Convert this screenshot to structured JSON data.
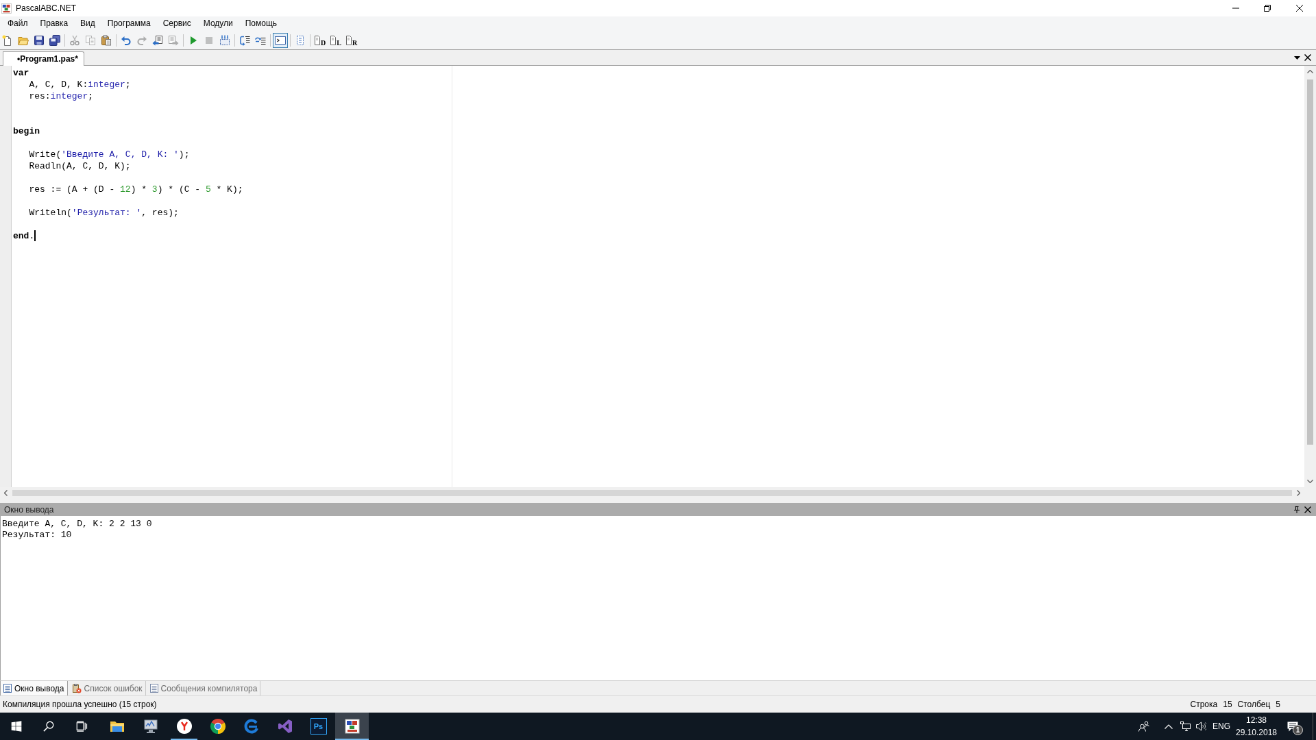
{
  "window": {
    "title": "PascalABC.NET"
  },
  "menu": [
    "Файл",
    "Правка",
    "Вид",
    "Программа",
    "Сервис",
    "Модули",
    "Помощь"
  ],
  "toolbar": {
    "groups": [
      {
        "buttons": [
          {
            "disabled": false,
            "pressed": false
          },
          {
            "disabled": false,
            "pressed": false
          },
          {
            "disabled": false,
            "pressed": false
          },
          {
            "disabled": false,
            "pressed": false
          }
        ]
      },
      {
        "buttons": [
          {
            "disabled": true,
            "pressed": false
          },
          {
            "disabled": true,
            "pressed": false
          },
          {
            "disabled": false,
            "pressed": false
          }
        ]
      },
      {
        "buttons": [
          {
            "disabled": false,
            "pressed": false
          },
          {
            "disabled": true,
            "pressed": false
          },
          {
            "disabled": false,
            "pressed": false
          },
          {
            "disabled": true,
            "pressed": false
          }
        ]
      },
      {
        "buttons": [
          {
            "disabled": false,
            "pressed": false
          },
          {
            "disabled": true,
            "pressed": false
          },
          {
            "disabled": false,
            "pressed": false
          }
        ]
      },
      {
        "buttons": [
          {
            "disabled": false,
            "pressed": false
          },
          {
            "disabled": false,
            "pressed": false
          }
        ]
      },
      {
        "buttons": [
          {
            "disabled": false,
            "pressed": true
          }
        ]
      },
      {
        "buttons": [
          {
            "disabled": false,
            "pressed": false
          }
        ]
      },
      {
        "buttons": [
          {
            "label": "D",
            "disabled": false,
            "pressed": false
          },
          {
            "label": "L",
            "disabled": false,
            "pressed": false
          },
          {
            "label": "R",
            "disabled": false,
            "pressed": false
          }
        ]
      }
    ]
  },
  "editor": {
    "tabs": [
      {
        "label": "•Program1.pas*",
        "selected": true
      }
    ],
    "lines": [
      {
        "tokens": [
          {
            "kind": "keyword",
            "text": "var"
          }
        ],
        "caret": false
      },
      {
        "tokens": [
          {
            "kind": "plain",
            "text": "   A, C, D, K:"
          },
          {
            "kind": "type",
            "text": "integer"
          },
          {
            "kind": "plain",
            "text": ";"
          }
        ],
        "caret": false
      },
      {
        "tokens": [
          {
            "kind": "plain",
            "text": "   res:"
          },
          {
            "kind": "type",
            "text": "integer"
          },
          {
            "kind": "plain",
            "text": ";"
          }
        ],
        "caret": false
      },
      {
        "caret": false
      },
      {
        "caret": false
      },
      {
        "tokens": [
          {
            "kind": "keyword",
            "text": "begin"
          }
        ],
        "caret": false
      },
      {
        "caret": false
      },
      {
        "tokens": [
          {
            "kind": "plain",
            "text": "   Write("
          },
          {
            "kind": "string",
            "text": "'Введите A, C, D, K: '"
          },
          {
            "kind": "plain",
            "text": ");"
          }
        ],
        "caret": false
      },
      {
        "tokens": [
          {
            "kind": "plain",
            "text": "   Readln(A, C, D, K);"
          }
        ],
        "caret": false
      },
      {
        "caret": false
      },
      {
        "tokens": [
          {
            "kind": "plain",
            "text": "   res := (A + (D - "
          },
          {
            "kind": "number",
            "text": "12"
          },
          {
            "kind": "plain",
            "text": ") * "
          },
          {
            "kind": "number",
            "text": "3"
          },
          {
            "kind": "plain",
            "text": ") * (C - "
          },
          {
            "kind": "number",
            "text": "5"
          },
          {
            "kind": "plain",
            "text": " * K);"
          }
        ],
        "caret": false
      },
      {
        "caret": false
      },
      {
        "tokens": [
          {
            "kind": "plain",
            "text": "   Writeln("
          },
          {
            "kind": "string",
            "text": "'Результат: '"
          },
          {
            "kind": "plain",
            "text": ", res);"
          }
        ],
        "caret": false
      },
      {
        "caret": false
      },
      {
        "tokens": [
          {
            "kind": "keyword",
            "text": "end"
          },
          {
            "kind": "plain",
            "text": "."
          }
        ],
        "caret": true
      }
    ]
  },
  "output": {
    "title": "Окно вывода",
    "lines": [
      "Введите A, C, D, K: 2 2 13 0",
      "Результат: 10"
    ]
  },
  "bottom_tabs": [
    {
      "label": "Окно вывода",
      "selected": true
    },
    {
      "label": "Список ошибок",
      "selected": false
    },
    {
      "label": "Сообщения компилятора",
      "selected": false
    }
  ],
  "status_bar": {
    "message": "Компиляция прошла успешно (15 строк)",
    "row_label": "Строка",
    "row": "15",
    "column_label": "Столбец",
    "column": "5"
  },
  "taskbar": {
    "apps": [
      {
        "running": false,
        "selected": false
      },
      {
        "running": false,
        "selected": false
      },
      {
        "running": true,
        "selected": false
      },
      {
        "running": false,
        "selected": false
      },
      {
        "running": false,
        "selected": false
      },
      {
        "running": false,
        "selected": false
      },
      {
        "label": "Ps",
        "running": false,
        "selected": false
      },
      {
        "running": true,
        "selected": true
      }
    ],
    "tray": {
      "language": "ENG",
      "time": "12:38",
      "date": "29.10.2018",
      "notifications": "1"
    }
  }
}
